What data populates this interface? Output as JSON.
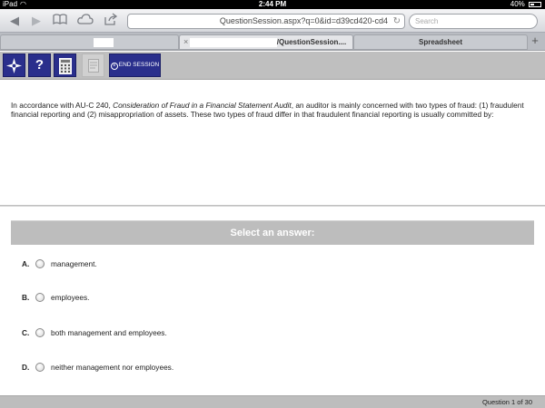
{
  "status_bar": {
    "device": "iPad",
    "time": "2:44 PM",
    "battery": "40%"
  },
  "browser": {
    "url": "QuestionSession.aspx?q=0&id=d39cd420-cd4",
    "search_placeholder": "Search",
    "tabs": [
      {
        "label": ""
      },
      {
        "label": "/QuestionSession...."
      },
      {
        "label": "Spreadsheet"
      }
    ]
  },
  "app_toolbar": {
    "end_session_label": "END SESSION"
  },
  "question": {
    "text_before": "In accordance with AU-C 240, ",
    "text_italic": "Consideration of Fraud in a Financial Statement Audit",
    "text_after": ", an auditor is mainly concerned with two types of fraud: (1) fraudulent financial reporting and (2) misappropriation of assets. These two types of fraud differ in that fraudulent financial reporting is usually committed by:"
  },
  "answers": {
    "header": "Select an answer:",
    "options": [
      {
        "letter": "A.",
        "text": "management."
      },
      {
        "letter": "B.",
        "text": "employees."
      },
      {
        "letter": "C.",
        "text": "both management and employees."
      },
      {
        "letter": "D.",
        "text": "neither management nor employees."
      }
    ]
  },
  "footer": {
    "progress": "Question 1 of 30"
  },
  "colors": {
    "app_button": "#2a2f8c",
    "answer_header": "#bdbdbd",
    "toolbar": "#bfbfbf"
  }
}
